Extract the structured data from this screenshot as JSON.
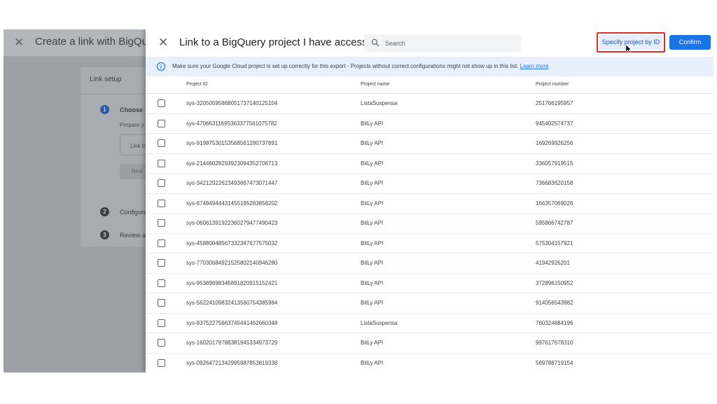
{
  "background": {
    "title": "Create a link with BigQuery",
    "card_title": "Link setup",
    "steps": [
      {
        "number": "1",
        "label": "Choose"
      },
      {
        "number": "2",
        "label": "Configure"
      },
      {
        "number": "3",
        "label": "Review ar"
      }
    ],
    "step1_desc": "Prepare y",
    "choose_button": "Link to",
    "next_button": "Next"
  },
  "drawer": {
    "title": "Link to a BigQuery project I have access to",
    "search_placeholder": "Search",
    "specify_button": "Specify project by ID",
    "confirm_button": "Confirm",
    "banner_text": "Make sure your Google Cloud project is set up correctly for this export - Projects without correct configurations might not show up in this list.",
    "banner_link": "Learn more",
    "columns": [
      "Project ID",
      "Project name",
      "Project number"
    ],
    "rows": [
      {
        "id": "sys-32050595868051737140125104",
        "name": "ListaSuspensa",
        "number": "251766195957"
      },
      {
        "id": "sys-47066311695363377561075782",
        "name": "BitLy API",
        "number": "945402574737"
      },
      {
        "id": "sys-91987530153568561280737891",
        "name": "BitLy API",
        "number": "169269926256"
      },
      {
        "id": "sys-21446028293923094352706713",
        "name": "BitLy API",
        "number": "336057919515"
      },
      {
        "id": "sys-34212922623493667473071447",
        "name": "BitLy API",
        "number": "736683620158"
      },
      {
        "id": "sys-67484944431455195283858202",
        "name": "BitLy API",
        "number": "166357069026"
      },
      {
        "id": "sys-06061391922360279477490423",
        "name": "BitLy API",
        "number": "595866742787"
      },
      {
        "id": "sys-45880048567332347677575032",
        "name": "BitLy API",
        "number": "575304157921"
      },
      {
        "id": "sys-77030684921525802140946280",
        "name": "BitLy API",
        "number": "41942926201"
      },
      {
        "id": "sys-95389698346891820915152421",
        "name": "BitLy API",
        "number": "372896150952"
      },
      {
        "id": "sys-56224109832413560754385984",
        "name": "BitLy API",
        "number": "914056543982"
      },
      {
        "id": "sys-83752275663745441462660348",
        "name": "ListaSuspensa",
        "number": "760324884196"
      },
      {
        "id": "sys-16020179788381945334973729",
        "name": "BitLy API",
        "number": "997617678310"
      },
      {
        "id": "sys-09264721342995987853819338",
        "name": "BitLy API",
        "number": "569788719154"
      }
    ]
  },
  "icons": {
    "close": "close-icon",
    "search": "search-icon",
    "info": "info-icon",
    "checkbox": "checkbox-icon",
    "cursor": "mouse-cursor-icon"
  },
  "colors": {
    "primary": "#1a73e8",
    "highlight_border": "#d93025",
    "banner_bg": "#e8f0fe"
  }
}
